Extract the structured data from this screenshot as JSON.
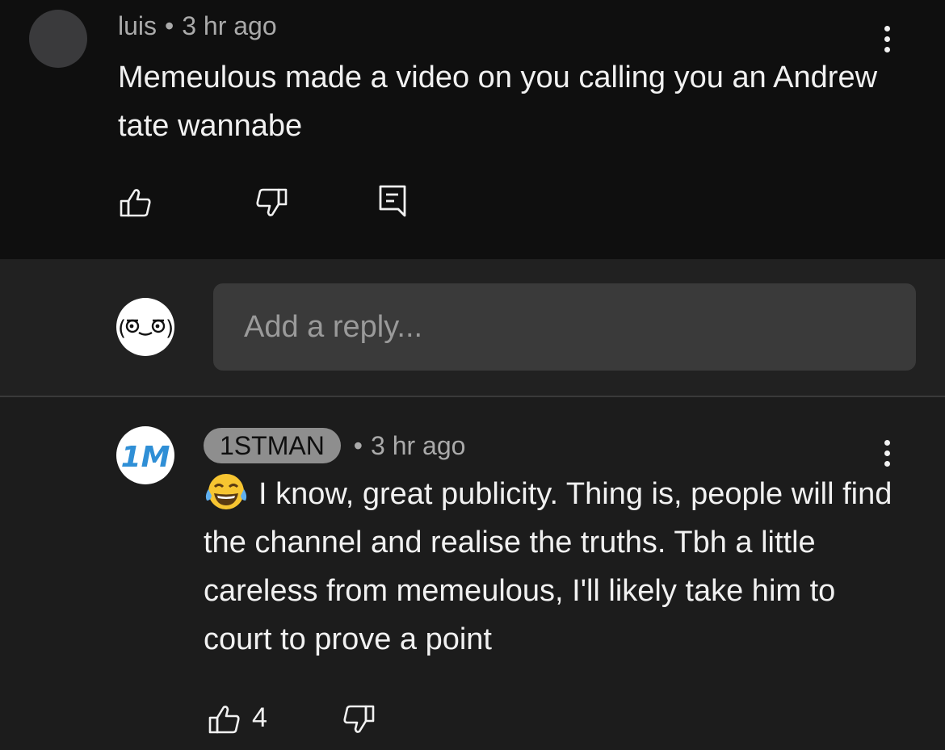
{
  "top_comment": {
    "author": "luis",
    "separator": "•",
    "time": "3 hr ago",
    "text": "Memeulous made a video on you calling you an Andrew tate wannabe",
    "actions": {
      "like_icon": "thumbs-up-icon",
      "dislike_icon": "thumbs-down-icon",
      "reply_icon": "reply-comment-icon"
    }
  },
  "reply_box": {
    "placeholder": "Add a reply..."
  },
  "reply_comment": {
    "author": "1STMAN",
    "separator": "•",
    "time": "3 hr ago",
    "emoji": "face-with-tears-of-joy",
    "text": "I know, great publicity. Thing is, people will find the channel and realise the truths. Tbh a little careless from memeulous, I'll likely take him to court to prove a point",
    "like_count": "4",
    "avatar_text": "1M"
  },
  "colors": {
    "background": "#0f0f0f",
    "reply_area": "#212121",
    "input_bg": "#3a3a3a",
    "author_badge": "#8e8e8e",
    "brand_blue": "#2f8fd6"
  }
}
